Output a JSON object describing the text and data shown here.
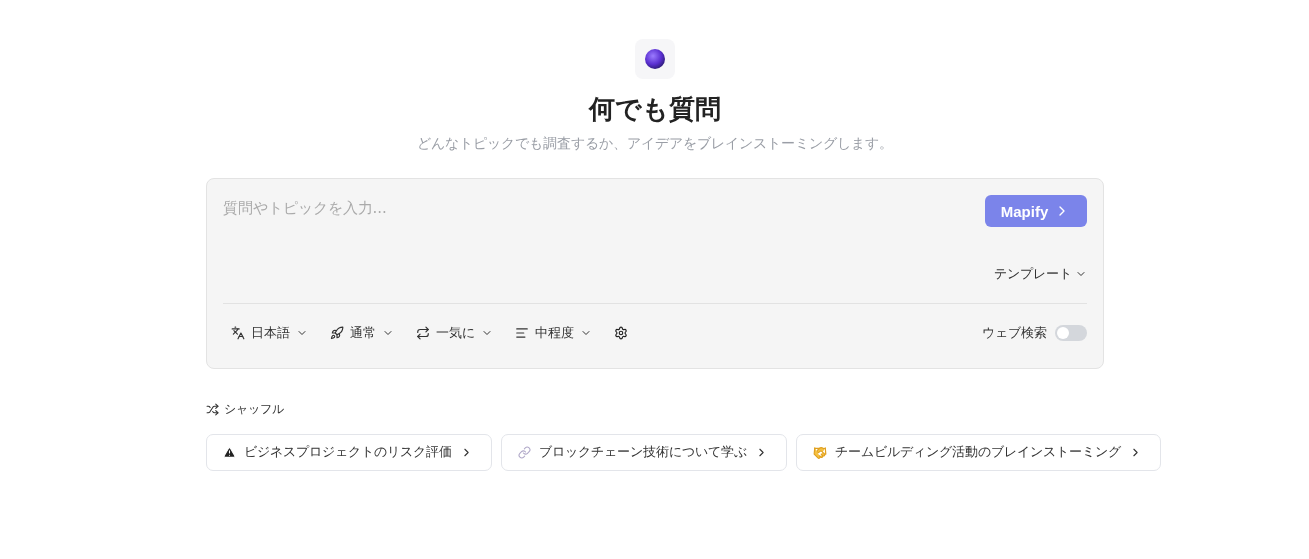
{
  "header": {
    "title": "何でも質問",
    "subtitle": "どんなトピックでも調査するか、アイデアをブレインストーミングします。"
  },
  "prompt": {
    "placeholder": "質問やトピックを入力...",
    "submit": "Mapify",
    "template": "テンプレート",
    "options": [
      {
        "kind": "language",
        "label": "日本語"
      },
      {
        "kind": "mode",
        "label": "通常"
      },
      {
        "kind": "flow",
        "label": "一気に"
      },
      {
        "kind": "detail",
        "label": "中程度"
      }
    ],
    "web_search": {
      "label": "ウェブ検索",
      "on": false
    }
  },
  "shuffle": "シャッフル",
  "suggestions": [
    {
      "kind": "warning",
      "label": "ビジネスプロジェクトのリスク評価"
    },
    {
      "kind": "link",
      "label": "ブロックチェーン技術について学ぶ"
    },
    {
      "kind": "handshake",
      "label": "チームビルディング活動のブレインストーミング"
    }
  ]
}
